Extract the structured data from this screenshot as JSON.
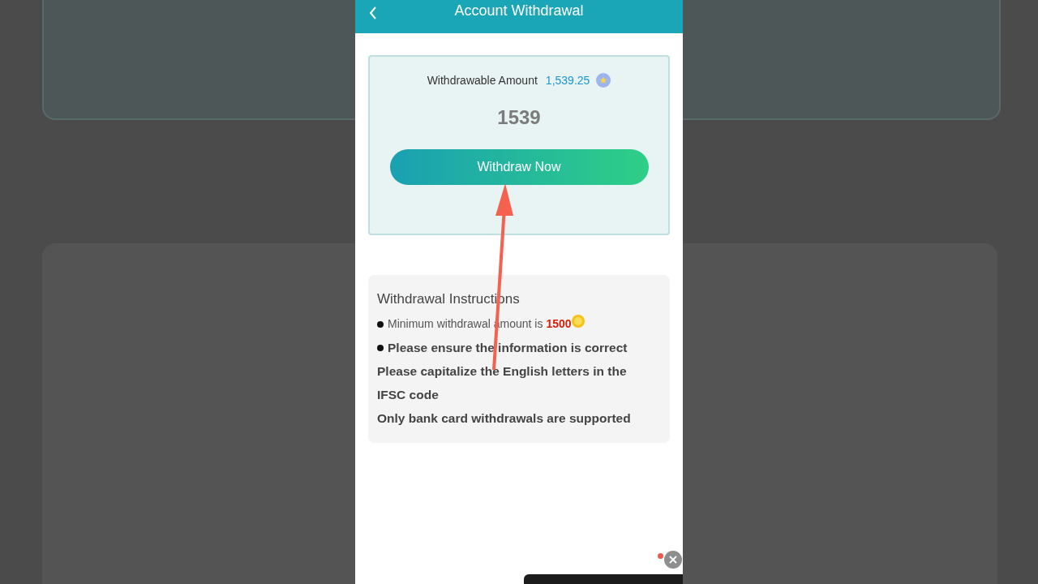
{
  "header": {
    "title": "Account Withdrawal"
  },
  "balance_card": {
    "label": "Withdrawable Amount",
    "amount": "1,539.25",
    "input_value": "1539",
    "button": "Withdraw Now"
  },
  "instructions": {
    "title": "Withdrawal Instructions",
    "items": [
      {
        "kind": "minimum",
        "bullet": true,
        "text": "Minimum withdrawal amount is",
        "amount": "1500"
      },
      {
        "kind": "note",
        "bullet": true,
        "text": "Please ensure the information is correct"
      },
      {
        "kind": "note",
        "bullet": false,
        "text": "Please capitalize the English letters in the IFSC code"
      },
      {
        "kind": "note",
        "bullet": false,
        "text": "Only bank card withdrawals are supported"
      }
    ]
  }
}
